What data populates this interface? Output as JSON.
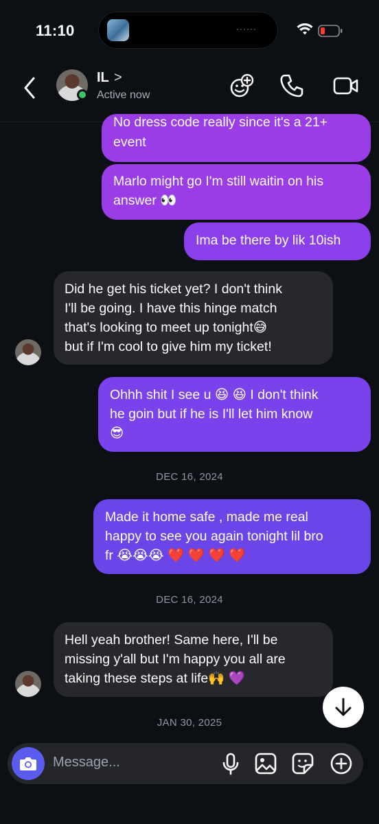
{
  "status_bar": {
    "time": "11:10",
    "island_dots": "······"
  },
  "header": {
    "contact_name": "IL",
    "chevron": ">",
    "status": "Active now"
  },
  "messages": [
    {
      "side": "out",
      "lines": [
        "No dress code really since it's a 21+",
        "event"
      ]
    },
    {
      "side": "out",
      "lines": [
        "Marlo might go I'm still waitin on his",
        "answer 👀"
      ]
    },
    {
      "side": "out",
      "lines": [
        "Ima be there by lik 10ish"
      ]
    },
    {
      "side": "in",
      "lines": [
        "Did he get his ticket yet? I don't think",
        "I'll be going. I have this hinge match",
        "that's looking to meet up tonight😅",
        "but if I'm cool to give him my ticket!"
      ]
    },
    {
      "side": "out",
      "lines": [
        "Ohhh shit I see u 😆 😆  I don't think",
        "he goin but if he is I'll let him know",
        "😎"
      ]
    },
    {
      "side": "out",
      "lines": [
        "Made it home safe , made me real",
        "happy to see you again tonight lil bro",
        "fr 😭😭😭 ❤️ ❤️ ❤️ ❤️"
      ]
    },
    {
      "side": "in",
      "lines": [
        "Hell yeah brother! Same here, I'll be",
        "missing y'all but I'm happy you all are",
        "taking these steps at life🙌 💜"
      ]
    }
  ],
  "dates": [
    "DEC 16, 2024",
    "DEC 16, 2024",
    "JAN 30, 2025"
  ],
  "composer": {
    "placeholder": "Message..."
  },
  "colors": {
    "bubble_out_top": "#9a3de6",
    "bubble_out_bottom": "#6a46e8",
    "bubble_in": "#26282e",
    "camera_button": "#5a5bef",
    "online": "#3ac569"
  }
}
